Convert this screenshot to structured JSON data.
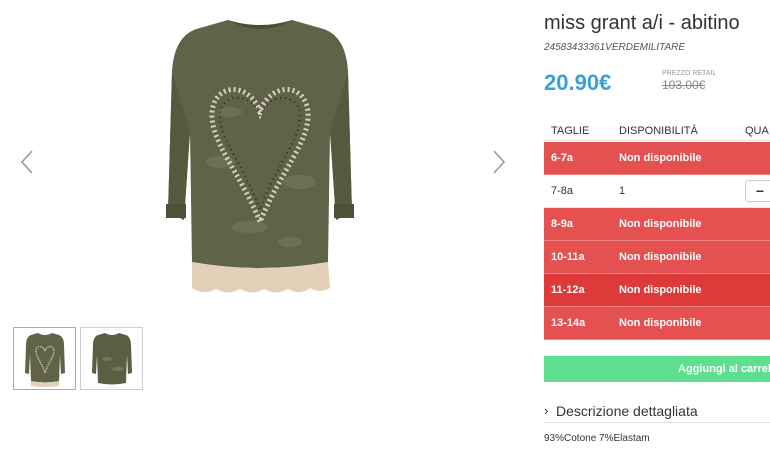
{
  "product": {
    "title": "miss grant a/i - abitino",
    "sku": "24583433361VERDEMILITARE",
    "price": "20.90€",
    "retail_label": "PREZZO RETAIL",
    "retail_price": "103.00€"
  },
  "sizes_table": {
    "headers": {
      "size": "TAGLIE",
      "availability": "DISPONIBILITÀ",
      "quantity": "QUA"
    },
    "rows": [
      {
        "size": "6-7a",
        "availability": "Non disponibile",
        "available": false
      },
      {
        "size": "7-8a",
        "availability": "1",
        "available": true,
        "qty_button": "−"
      },
      {
        "size": "8-9a",
        "availability": "Non disponibile",
        "available": false
      },
      {
        "size": "10-11a",
        "availability": "Non disponibile",
        "available": false
      },
      {
        "size": "11-12a",
        "availability": "Non disponibile",
        "available": false
      },
      {
        "size": "13-14a",
        "availability": "Non disponibile",
        "available": false
      }
    ]
  },
  "actions": {
    "add_to_cart": "Aggiungi al carrello"
  },
  "description": {
    "toggle_label": "Descrizione dettagliata",
    "composition": "93%Cotone 7%Elastam"
  },
  "colors": {
    "price": "#3aa0d8",
    "unavailable_row": "#e55050",
    "cart_button": "#5ddf8f",
    "thumb_active_border": "#e8a33d"
  },
  "icons": {
    "prev": "chevron-left-icon",
    "next": "chevron-right-icon",
    "desc": "chevron-right-icon"
  }
}
